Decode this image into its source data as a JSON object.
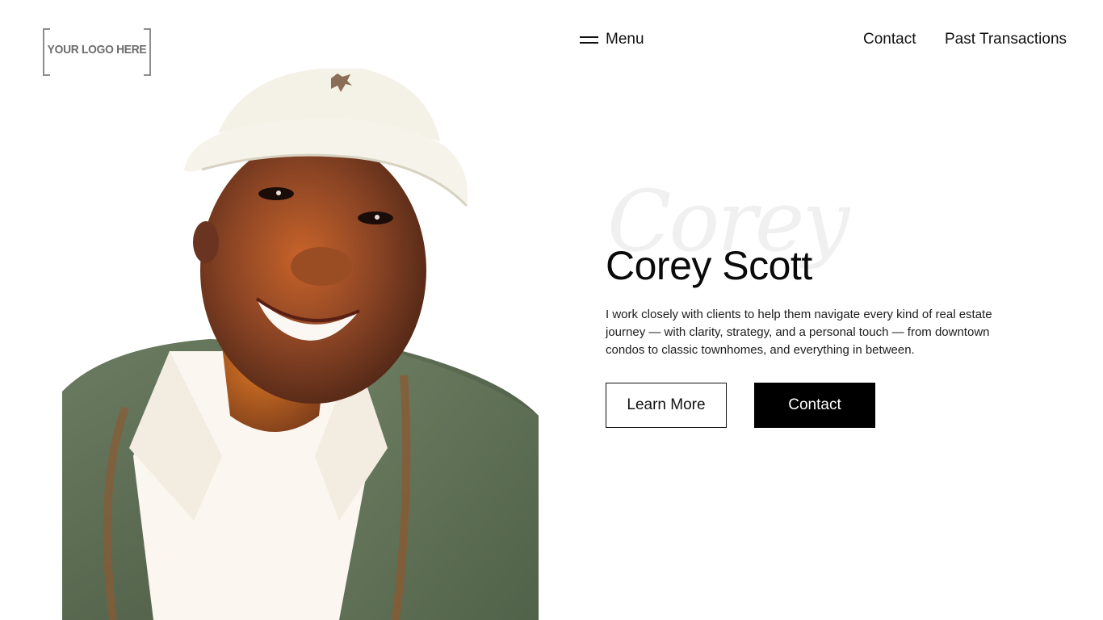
{
  "logo": {
    "text": "YOUR LOGO HERE"
  },
  "nav": {
    "menu_label": "Menu",
    "links": [
      {
        "label": "Contact"
      },
      {
        "label": "Past Transactions"
      }
    ]
  },
  "hero": {
    "script_name": "Corey",
    "name": "Corey Scott",
    "bio": "I work closely with clients to help them navigate every kind of real estate journey — with clarity, strategy, and a personal touch — from downtown condos to classic townhomes, and everything in between.",
    "learn_more_label": "Learn More",
    "contact_label": "Contact"
  },
  "colors": {
    "text": "#111111",
    "button_dark": "#000000",
    "jacket": "#5f7257",
    "skin": "#7a3f22",
    "cap": "#f2efe6"
  }
}
